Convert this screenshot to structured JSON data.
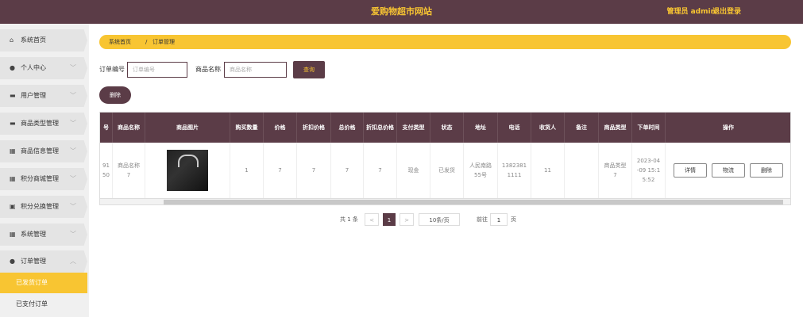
{
  "header": {
    "title": "爱购物超市网站",
    "user": "管理员 admin",
    "logout": "退出登录"
  },
  "sidebar": {
    "items": [
      {
        "label": "系统首页",
        "icon": "home-icon",
        "glyph": "⌂",
        "chevron": ""
      },
      {
        "label": "个人中心",
        "icon": "user-icon",
        "glyph": "●",
        "chevron": "﹀"
      },
      {
        "label": "用户管理",
        "icon": "chat-icon",
        "glyph": "▬",
        "chevron": "﹀"
      },
      {
        "label": "商品类型管理",
        "icon": "chat-icon",
        "glyph": "▬",
        "chevron": "﹀"
      },
      {
        "label": "商品信息管理",
        "icon": "grid-icon",
        "glyph": "▦",
        "chevron": "﹀"
      },
      {
        "label": "积分商城管理",
        "icon": "grid-icon",
        "glyph": "▦",
        "chevron": "﹀"
      },
      {
        "label": "积分兑换管理",
        "icon": "clipboard-icon",
        "glyph": "▣",
        "chevron": "﹀"
      },
      {
        "label": "系统管理",
        "icon": "grid-icon",
        "glyph": "▦",
        "chevron": "﹀"
      },
      {
        "label": "订单管理",
        "icon": "user-icon",
        "glyph": "●",
        "chevron": "︿"
      }
    ],
    "subitems": [
      {
        "label": "已发货订单",
        "active": true
      },
      {
        "label": "已支付订单",
        "active": false
      }
    ]
  },
  "breadcrumb": {
    "home": "系统首页",
    "separator": "/",
    "current": "订单管理"
  },
  "filters": {
    "order_no_label": "订单编号",
    "order_no_placeholder": "订单编号",
    "product_name_label": "商品名称",
    "product_name_placeholder": "商品名称",
    "query_button": "查询"
  },
  "actions": {
    "delete_button": "删除"
  },
  "table": {
    "columns": [
      "号",
      "商品名称",
      "商品图片",
      "购买数量",
      "价格",
      "折扣价格",
      "总价格",
      "折扣总价格",
      "支付类型",
      "状态",
      "地址",
      "电话",
      "收货人",
      "备注",
      "商品类型",
      "下单时间",
      "操作"
    ],
    "rows": [
      {
        "no": "91\n50",
        "product": "商品名称\n7",
        "qty": "1",
        "price": "7",
        "discount_price": "7",
        "total": "7",
        "discount_total": "7",
        "pay_type": "现金",
        "status": "已发货",
        "address": "人民南路\n55号",
        "phone": "1382381\n1111",
        "receiver": "11",
        "remark": "",
        "category": "商品类型\n7",
        "time": "2023-04\n-09 15:1\n5:52",
        "ops": [
          "详情",
          "物流",
          "删除"
        ]
      }
    ]
  },
  "pagination": {
    "total": "共 1 条",
    "prev": "<",
    "page": "1",
    "next": ">",
    "page_size": "10条/页",
    "goto_label": "前往",
    "goto_value": "1",
    "goto_suffix": "页"
  }
}
